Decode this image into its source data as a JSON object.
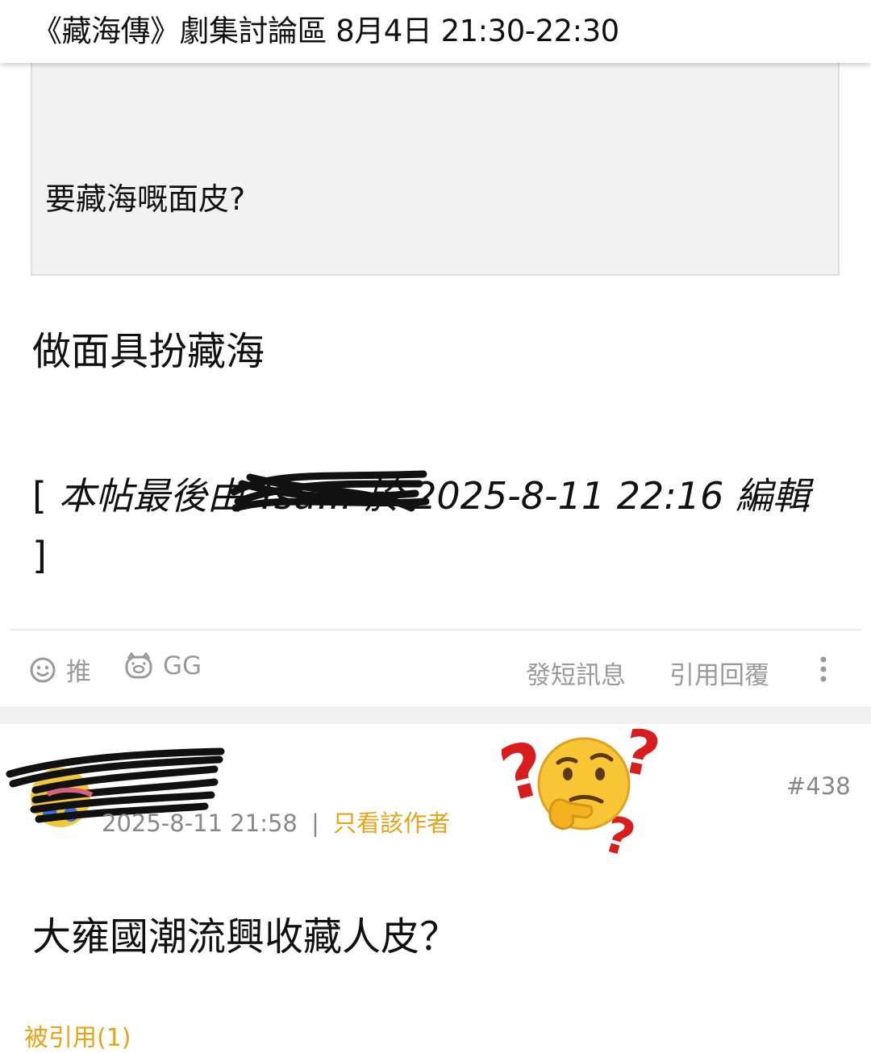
{
  "header": {
    "title": "《藏海傳》劇集討論區 8月4日 21:30-22:30"
  },
  "quote": {
    "text": "要藏海嘅面皮?"
  },
  "post": {
    "body": "做面具扮藏海",
    "edit_note": {
      "open_bracket": "[",
      "prefix": "本帖最後由",
      "editor": "Tsu...",
      "mid": "於 2025-8-11 22:16 編輯",
      "close_bracket": "]"
    },
    "actions": {
      "like_label": "推",
      "dislike_label": "GG",
      "pm_label": "發短訊息",
      "quote_reply_label": "引用回覆"
    }
  },
  "reply": {
    "timestamp": "2025-8-11 21:58",
    "separator": "|",
    "author_only_label": "只看該作者",
    "post_number": "#438",
    "body": "大雍國潮流興收藏人皮？",
    "quoted_label": "被引用(1)"
  },
  "colors": {
    "accent": "#e8a316",
    "muted": "#9a9a9a",
    "quote_bg": "#f2f2f2",
    "question_mark": "#d91d1d"
  },
  "icons": {
    "like": "smiling-face-icon",
    "dislike": "pig-face-icon",
    "more": "more-vertical-icon",
    "thinking": "thinking-face-emoji"
  }
}
